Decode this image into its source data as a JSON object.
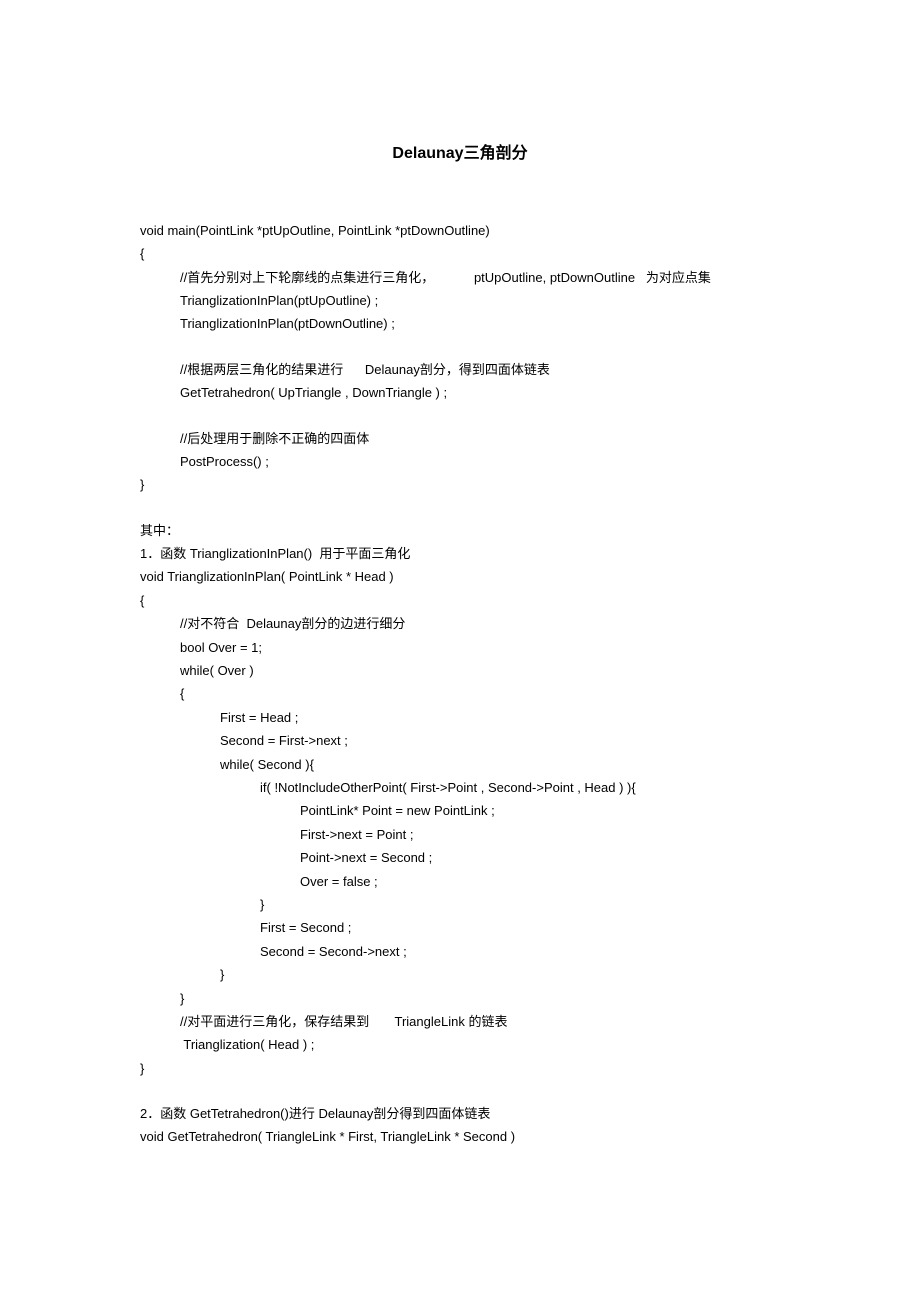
{
  "title": "Delaunay三角剖分",
  "lines": [
    {
      "indent": 0,
      "text": "void main(PointLink *ptUpOutline, PointLink *ptDownOutline)"
    },
    {
      "indent": 0,
      "text": "{"
    },
    {
      "indent": 1,
      "text": "//首先分别对上下轮廓线的点集进行三角化，           ptUpOutline, ptDownOutline   为对应点集"
    },
    {
      "indent": 1,
      "text": "TrianglizationInPlan(ptUpOutline) ;"
    },
    {
      "indent": 1,
      "text": "TrianglizationInPlan(ptDownOutline) ;"
    },
    {
      "indent": -1,
      "text": ""
    },
    {
      "indent": 1,
      "text": "//根据两层三角化的结果进行      Delaunay剖分，得到四面体链表"
    },
    {
      "indent": 1,
      "text": "GetTetrahedron( UpTriangle , DownTriangle ) ;"
    },
    {
      "indent": -1,
      "text": ""
    },
    {
      "indent": 1,
      "text": "//后处理用于删除不正确的四面体"
    },
    {
      "indent": 1,
      "text": "PostProcess() ;"
    },
    {
      "indent": 0,
      "text": "}"
    },
    {
      "indent": -1,
      "text": ""
    },
    {
      "indent": 0,
      "text": "其中："
    },
    {
      "indent": 0,
      "text": "1．函数 TrianglizationInPlan()  用于平面三角化"
    },
    {
      "indent": 0,
      "text": "void TrianglizationInPlan( PointLink * Head )"
    },
    {
      "indent": 0,
      "text": "{"
    },
    {
      "indent": 1,
      "text": "//对不符合  Delaunay剖分的边进行细分"
    },
    {
      "indent": 1,
      "text": "bool Over = 1;"
    },
    {
      "indent": 1,
      "text": "while( Over )"
    },
    {
      "indent": 1,
      "text": "{"
    },
    {
      "indent": 2,
      "text": "First = Head ;"
    },
    {
      "indent": 2,
      "text": "Second = First->next ;"
    },
    {
      "indent": 2,
      "text": "while( Second ){"
    },
    {
      "indent": 3,
      "text": "if( !NotIncludeOtherPoint( First->Point , Second->Point , Head ) ){"
    },
    {
      "indent": 4,
      "text": "PointLink* Point = new PointLink ;"
    },
    {
      "indent": 4,
      "text": "First->next = Point ;"
    },
    {
      "indent": 4,
      "text": "Point->next = Second ;"
    },
    {
      "indent": 4,
      "text": "Over = false ;"
    },
    {
      "indent": 3,
      "text": "}"
    },
    {
      "indent": 3,
      "text": "First = Second ;"
    },
    {
      "indent": 3,
      "text": "Second = Second->next ;"
    },
    {
      "indent": 2,
      "text": "}"
    },
    {
      "indent": 1,
      "text": "}"
    },
    {
      "indent": 1,
      "text": "//对平面进行三角化，保存结果到       TriangleLink 的链表"
    },
    {
      "indent": 1,
      "text": " Trianglization( Head ) ;"
    },
    {
      "indent": 0,
      "text": "}"
    },
    {
      "indent": -1,
      "text": ""
    },
    {
      "indent": 0,
      "text": "2．函数 GetTetrahedron()进行 Delaunay剖分得到四面体链表"
    },
    {
      "indent": 0,
      "text": "void GetTetrahedron( TriangleLink * First, TriangleLink * Second )"
    }
  ]
}
